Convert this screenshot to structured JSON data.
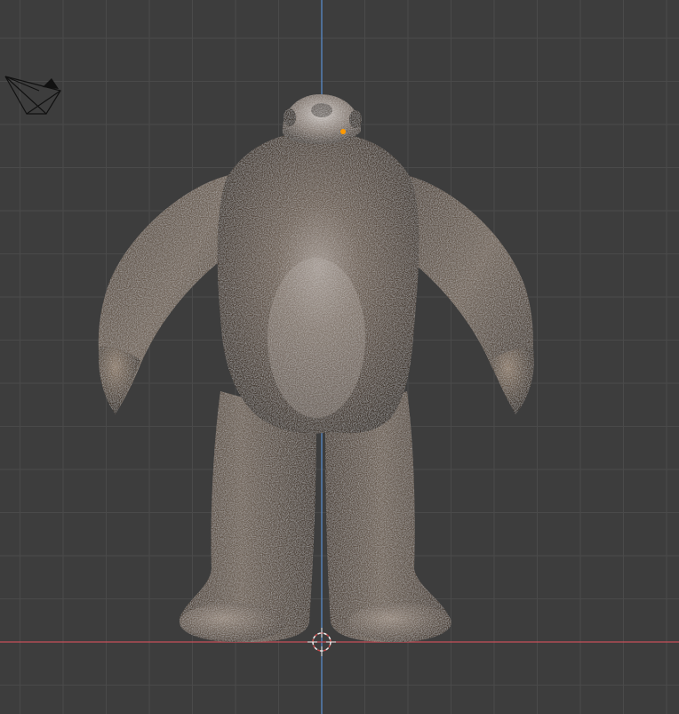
{
  "viewport": {
    "view": "front-orthographic",
    "shading": "rendered",
    "object": "furry-creature-model",
    "colors": {
      "background": "#3d3d3d",
      "grid_line": "#4a4a4a",
      "x_axis": "#c7505a",
      "z_axis": "#5b8fd1",
      "fur_dark": "#3b3128",
      "fur_mid": "#5e5145",
      "fur_light": "#a89d92",
      "skin": "#7a6a5c",
      "origin_dot": "#ff9a00",
      "cursor_ring": "#e9e9e9",
      "cursor_dash": "#c84a4a"
    },
    "icons": [
      "camera-icon",
      "3d-cursor-icon",
      "origin-point-icon"
    ]
  }
}
